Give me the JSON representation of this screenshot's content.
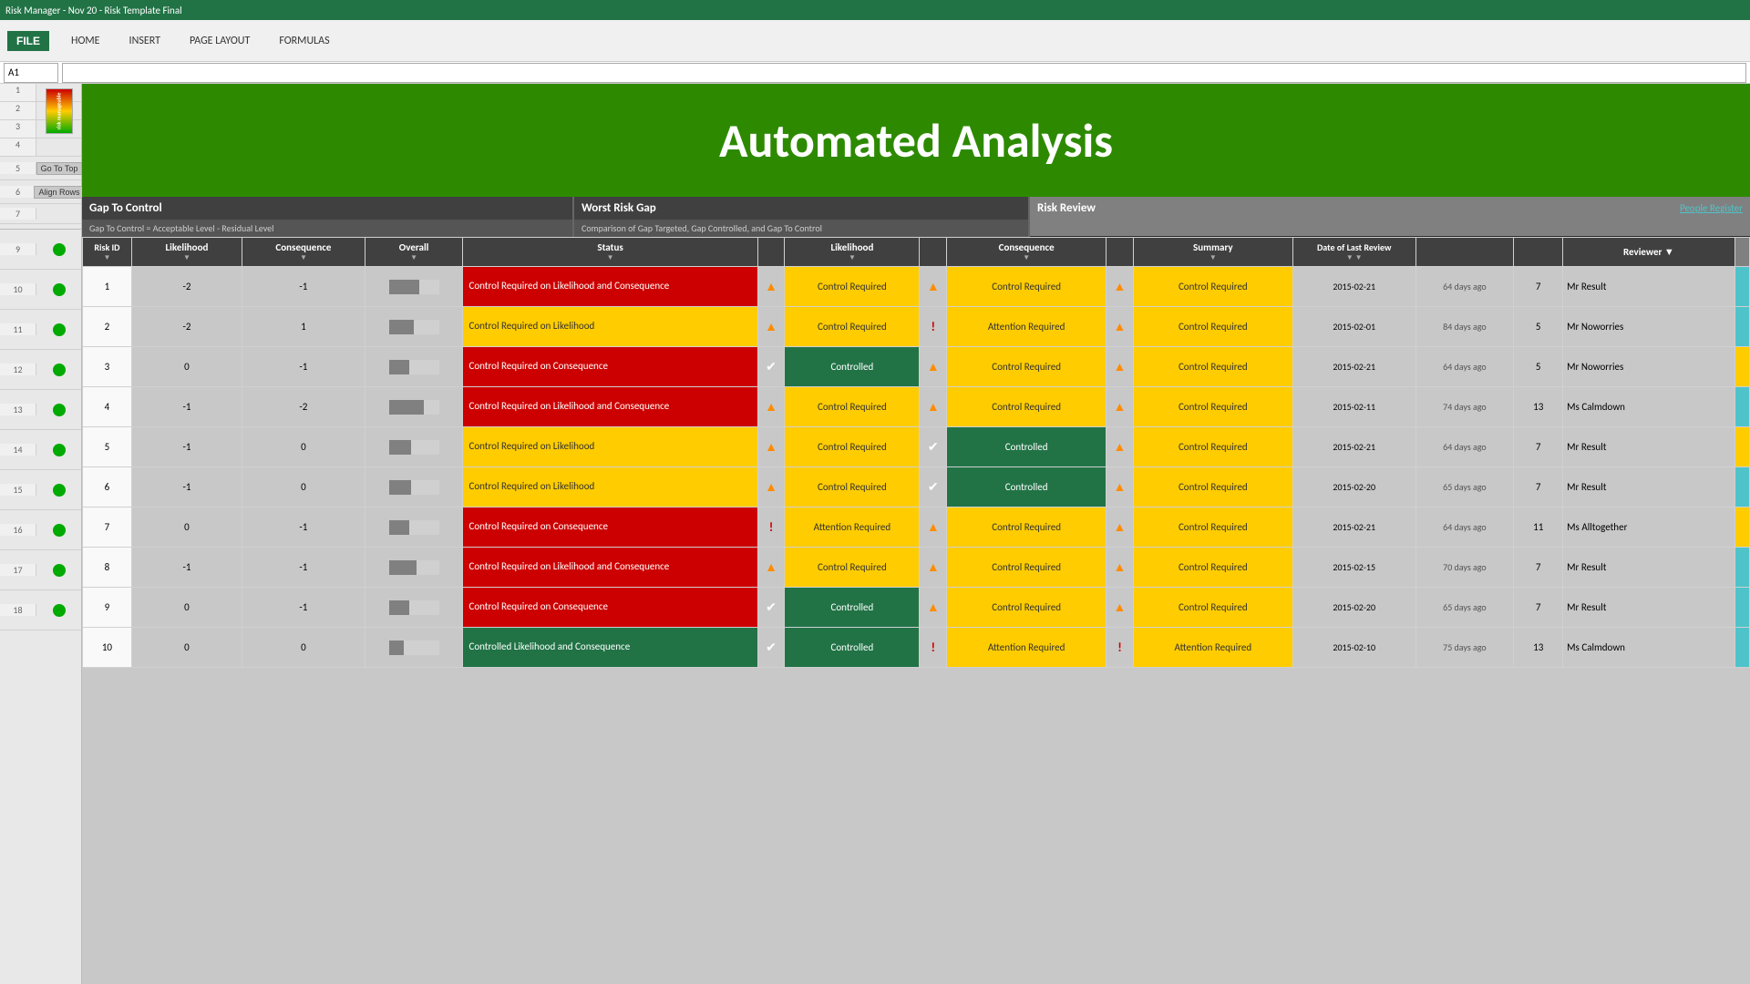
{
  "excel": {
    "file_tab": "FILE",
    "tabs": [
      "HOME",
      "INSERT",
      "PAGE LAYOUT",
      "FORMULAS"
    ],
    "name_box": "A1",
    "title": "Risk Manager - Nov 20 - Risk Template Final"
  },
  "banner": {
    "title": "Automated Analysis"
  },
  "gap_to_control": {
    "heading": "Gap To Control",
    "subtext": "Gap To Control = Acceptable Level - Residual Level"
  },
  "worst_risk_gap": {
    "heading": "Worst Risk Gap",
    "subtext": "Comparison of Gap Targeted, Gap Controlled, and Gap To Control"
  },
  "risk_review": {
    "heading": "Risk Review",
    "people_link": "People Register"
  },
  "columns": {
    "risk_id": "Risk ID",
    "likelihood": "Likelihood",
    "consequence": "Consequence",
    "overall": "Overall",
    "status": "Status",
    "w_likelihood": "Likelihood",
    "w_consequence": "Consequence",
    "summary": "Summary",
    "date_review": "Date of Last Review",
    "days_ago": "",
    "num": "",
    "reviewer": "Reviewer ▼"
  },
  "buttons": {
    "go_top": "Go To Top",
    "align_rows": "Align Rows"
  },
  "rows": [
    {
      "num": 9,
      "id": 1,
      "likelihood": -2,
      "consequence": -1,
      "overall_bar": 60,
      "status": "Control Required on Likelihood and Consequence",
      "status_class": "red",
      "w_lik_icon": "triangle",
      "w_lik": "Control Required",
      "w_lik_class": "yellow",
      "w_con_icon": "triangle",
      "w_con": "Control Required",
      "w_con_class": "yellow",
      "sum_icon": "triangle",
      "summary": "Control Required",
      "sum_class": "yellow",
      "date": "2015-02-21",
      "days": "64 days ago",
      "rev_num": 7,
      "reviewer": "Mr Result",
      "right_color": "#4FC3CA"
    },
    {
      "num": 10,
      "id": 2,
      "likelihood": -2,
      "consequence": 1,
      "overall_bar": 50,
      "status": "Control Required on Likelihood",
      "status_class": "yellow",
      "w_lik_icon": "triangle",
      "w_lik": "Control Required",
      "w_lik_class": "yellow",
      "w_con_icon": "exclaim",
      "w_con": "Attention Required",
      "w_con_class": "yellow",
      "sum_icon": "triangle",
      "summary": "Control Required",
      "sum_class": "yellow",
      "date": "2015-02-01",
      "days": "84 days ago",
      "rev_num": 5,
      "reviewer": "Mr Noworries",
      "right_color": "#4FC3CA"
    },
    {
      "num": 11,
      "id": 3,
      "likelihood": 0,
      "consequence": -1,
      "overall_bar": 40,
      "status": "Control Required on Consequence",
      "status_class": "red",
      "w_lik_icon": "check",
      "w_lik": "Controlled",
      "w_lik_class": "green",
      "w_con_icon": "triangle",
      "w_con": "Control Required",
      "w_con_class": "yellow",
      "sum_icon": "triangle",
      "summary": "Control Required",
      "sum_class": "yellow",
      "date": "2015-02-21",
      "days": "64 days ago",
      "rev_num": 5,
      "reviewer": "Mr Noworries",
      "right_color": "#FFCC00"
    },
    {
      "num": 12,
      "id": 4,
      "likelihood": -1,
      "consequence": -2,
      "overall_bar": 70,
      "status": "Control Required on Likelihood and Consequence",
      "status_class": "red",
      "w_lik_icon": "triangle",
      "w_lik": "Control Required",
      "w_lik_class": "yellow",
      "w_con_icon": "triangle",
      "w_con": "Control Required",
      "w_con_class": "yellow",
      "sum_icon": "triangle",
      "summary": "Control Required",
      "sum_class": "yellow",
      "date": "2015-02-11",
      "days": "74 days ago",
      "rev_num": 13,
      "reviewer": "Ms Calmdown",
      "right_color": "#4FC3CA"
    },
    {
      "num": 13,
      "id": 5,
      "likelihood": -1,
      "consequence": 0,
      "overall_bar": 45,
      "status": "Control Required on Likelihood",
      "status_class": "yellow",
      "w_lik_icon": "triangle",
      "w_lik": "Control Required",
      "w_lik_class": "yellow",
      "w_con_icon": "check",
      "w_con": "Controlled",
      "w_con_class": "green",
      "sum_icon": "triangle",
      "summary": "Control Required",
      "sum_class": "yellow",
      "date": "2015-02-21",
      "days": "64 days ago",
      "rev_num": 7,
      "reviewer": "Mr Result",
      "right_color": "#FFCC00"
    },
    {
      "num": 14,
      "id": 6,
      "likelihood": -1,
      "consequence": 0,
      "overall_bar": 45,
      "status": "Control Required on Likelihood",
      "status_class": "yellow",
      "w_lik_icon": "triangle",
      "w_lik": "Control Required",
      "w_lik_class": "yellow",
      "w_con_icon": "check",
      "w_con": "Controlled",
      "w_con_class": "green",
      "sum_icon": "triangle",
      "summary": "Control Required",
      "sum_class": "yellow",
      "date": "2015-02-20",
      "days": "65 days ago",
      "rev_num": 7,
      "reviewer": "Mr Result",
      "right_color": "#4FC3CA"
    },
    {
      "num": 15,
      "id": 7,
      "likelihood": 0,
      "consequence": -1,
      "overall_bar": 40,
      "status": "Control Required on Consequence",
      "status_class": "red",
      "w_lik_icon": "exclaim",
      "w_lik": "Attention Required",
      "w_lik_class": "yellow",
      "w_con_icon": "triangle",
      "w_con": "Control Required",
      "w_con_class": "yellow",
      "sum_icon": "triangle",
      "summary": "Control Required",
      "sum_class": "yellow",
      "date": "2015-02-21",
      "days": "64 days ago",
      "rev_num": 11,
      "reviewer": "Ms Alltogether",
      "right_color": "#FFCC00"
    },
    {
      "num": 16,
      "id": 8,
      "likelihood": -1,
      "consequence": -1,
      "overall_bar": 55,
      "status": "Control Required on Likelihood and Consequence",
      "status_class": "red",
      "w_lik_icon": "triangle",
      "w_lik": "Control Required",
      "w_lik_class": "yellow",
      "w_con_icon": "triangle",
      "w_con": "Control Required",
      "w_con_class": "yellow",
      "sum_icon": "triangle",
      "summary": "Control Required",
      "sum_class": "yellow",
      "date": "2015-02-15",
      "days": "70 days ago",
      "rev_num": 7,
      "reviewer": "Mr Result",
      "right_color": "#4FC3CA"
    },
    {
      "num": 17,
      "id": 9,
      "likelihood": 0,
      "consequence": -1,
      "overall_bar": 40,
      "status": "Control Required on Consequence",
      "status_class": "red",
      "w_lik_icon": "check",
      "w_lik": "Controlled",
      "w_lik_class": "green",
      "w_con_icon": "triangle",
      "w_con": "Control Required",
      "w_con_class": "yellow",
      "sum_icon": "triangle",
      "summary": "Control Required",
      "sum_class": "yellow",
      "date": "2015-02-20",
      "days": "65 days ago",
      "rev_num": 7,
      "reviewer": "Mr Result",
      "right_color": "#4FC3CA"
    },
    {
      "num": 18,
      "id": 10,
      "likelihood": 0,
      "consequence": 0,
      "overall_bar": 30,
      "status": "Controlled Likelihood and Consequence",
      "status_class": "green",
      "w_lik_icon": "check",
      "w_lik": "Controlled",
      "w_lik_class": "green",
      "w_con_icon": "exclaim",
      "w_con": "Attention Required",
      "w_con_class": "yellow",
      "sum_icon": "exclaim",
      "summary": "Attention Required",
      "sum_class": "yellow",
      "date": "2015-02-10",
      "days": "75 days ago",
      "rev_num": 13,
      "reviewer": "Ms Calmdown",
      "right_color": "#4FC3CA"
    }
  ]
}
